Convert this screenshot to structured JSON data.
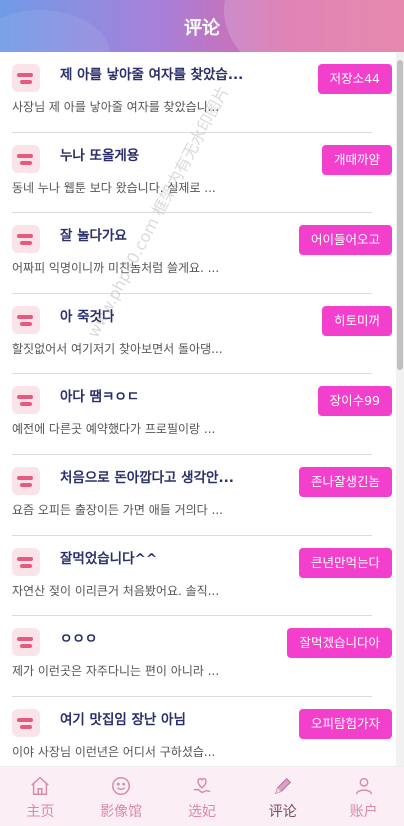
{
  "header": {
    "title": "评论"
  },
  "comments": [
    {
      "name": "제 아를 낳아줄 여자를 찾았습...",
      "preview": "사장님 제 아를 낳아줄 여자를 찾았습니...",
      "button": "저장소44"
    },
    {
      "name": "누나 또올게용",
      "preview": "동네 누나 웹툰 보다 왔습니다. 실제로 ...",
      "button": "개때까얌"
    },
    {
      "name": "잘 놀다가요",
      "preview": "어짜피 익명이니까 미친놈처럼 쓸게요. ...",
      "button": "어이들어오고"
    },
    {
      "name": "아 죽것다",
      "preview": "할짓없어서 여기저기 찾아보면서 돌아댕...",
      "button": "히토미꺼"
    },
    {
      "name": "아다 땜ㅋㅇㄷ",
      "preview": "예전에 다른곳 예약했다가 프로필이랑 ...",
      "button": "장이수99"
    },
    {
      "name": "처음으로 돈아깝다고 생각안...",
      "preview": "요즘 오피든 출장이든 가면 애들 거의다 ...",
      "button": "존나잘생긴놈"
    },
    {
      "name": "잘먹었습니다^^",
      "preview": "자연산 젖이 이리큰거 처음봤어요. 솔직...",
      "button": "큰년만먹는다"
    },
    {
      "name": "ㅇㅇㅇ",
      "preview": "제가 이런곳은 자주다니는 편이 아니라 ...",
      "button": "잘먹겠습니다아"
    },
    {
      "name": "여기 맛집임 장난 아님",
      "preview": "이야 사장님 이런년은 어디서 구하셨습...",
      "button": "오피탐험가자"
    }
  ],
  "watermark": "www.php80.com 框架内有无水印图片",
  "tabbar": {
    "items": [
      {
        "label": "主页",
        "icon": "home-icon"
      },
      {
        "label": "影像馆",
        "icon": "smile-icon"
      },
      {
        "label": "选妃",
        "icon": "heart-hand-icon"
      },
      {
        "label": "评论",
        "icon": "pencil-icon"
      },
      {
        "label": "账户",
        "icon": "user-icon"
      }
    ],
    "active_index": 3
  },
  "colors": {
    "accent": "#f23fcc",
    "tab_inactive": "#d98aaa",
    "tab_active": "#7a4a5a",
    "name_text": "#2a2f6a"
  }
}
